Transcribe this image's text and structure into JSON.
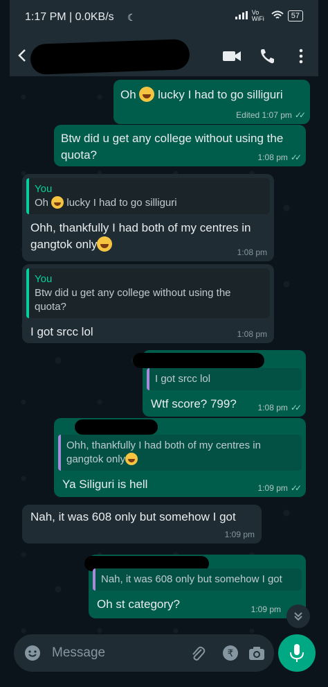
{
  "status_bar": {
    "time": "1:17 PM | 0.0KB/s",
    "network": "Vo WiFi",
    "battery": "57"
  },
  "header": {
    "contact_name": ""
  },
  "messages": [
    {
      "dir": "out",
      "text_before": "Oh ",
      "emoji": "😂",
      "text_after": " lucky I had to go silliguri",
      "time": "Edited 1:07 pm",
      "ticks": "✓✓"
    },
    {
      "dir": "out",
      "text": "Btw did u get any college without using the quota?",
      "time": "1:08 pm",
      "ticks": "✓✓"
    },
    {
      "dir": "in",
      "quote_author": "You",
      "quote_before": "Oh ",
      "quote_after": " lucky I had to go silliguri",
      "text": "Ohh, thankfully I had both of my centres in gangtok only",
      "time": "1:08 pm"
    },
    {
      "dir": "in",
      "quote_author": "You",
      "quote_text": "Btw did u get any college without using the quota?",
      "text": "I got srcc lol",
      "time": "1:08 pm"
    },
    {
      "dir": "out",
      "quote_text": "I got srcc lol",
      "text": "Wtf score? 799?",
      "time": "1:08 pm",
      "ticks": "✓✓"
    },
    {
      "dir": "out",
      "quote_text": "Ohh, thankfully I had both of my centres in gangtok only",
      "text": "Ya Siliguri is hell",
      "time": "1:09 pm",
      "ticks": "✓✓"
    },
    {
      "dir": "in",
      "text": "Nah, it was 608 only but somehow I got",
      "time": "1:09 pm"
    },
    {
      "dir": "out",
      "quote_text": "Nah, it was 608 only but somehow I got",
      "text": "Oh st category?",
      "time": "1:09 pm"
    }
  ],
  "composer": {
    "placeholder": "Message"
  },
  "colors": {
    "outgoing": "#005c4b",
    "incoming": "#202c33",
    "accent": "#00a884",
    "background": "#0b141a"
  },
  "icons": [
    "back-arrow-icon",
    "video-call-icon",
    "voice-call-icon",
    "more-options-icon",
    "emoji-icon",
    "attach-icon",
    "rupee-payment-icon",
    "camera-icon",
    "mic-icon",
    "scroll-down-icon"
  ]
}
